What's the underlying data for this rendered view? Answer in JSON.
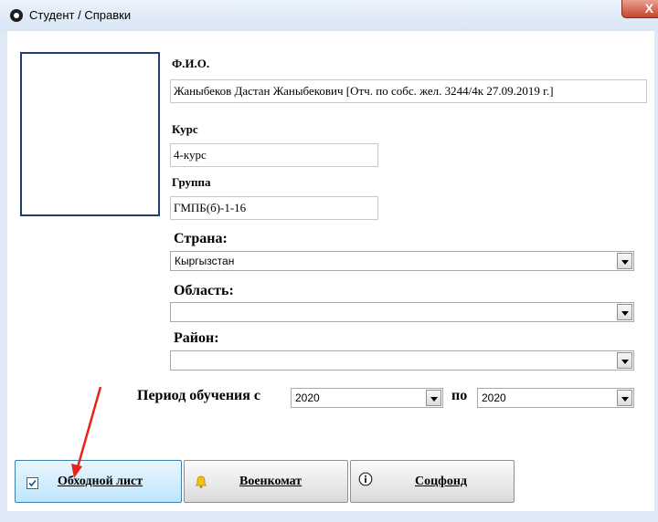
{
  "window": {
    "title": "Студент / Справки",
    "close_glyph": "X"
  },
  "fio": {
    "label": "Ф.И.О.",
    "value": "Жаныбеков Дастан Жаныбекович [Отч. по собс. жел. 3244/4к  27.09.2019 г.]"
  },
  "course": {
    "label": "Курс",
    "value": "4-курс"
  },
  "group": {
    "label": "Группа",
    "value": "ГМПБ(б)-1-16"
  },
  "country": {
    "label": "Страна:",
    "value": "Кыргызстан"
  },
  "region": {
    "label": "Область:",
    "value": ""
  },
  "district": {
    "label": "Район:",
    "value": ""
  },
  "period": {
    "label": "Период обучения с",
    "from": "2020",
    "to_label": "по",
    "to": "2020"
  },
  "buttons": [
    {
      "label": "Обходной лист",
      "icon": "checkbox-icon"
    },
    {
      "label": "Военкомат",
      "icon": "bell-icon"
    },
    {
      "label": "Соцфонд",
      "icon": "info-icon"
    }
  ],
  "colors": {
    "accent_arrow": "#e8231a",
    "active_button": "#bee6fd",
    "photo_border": "#1f3d6e"
  }
}
